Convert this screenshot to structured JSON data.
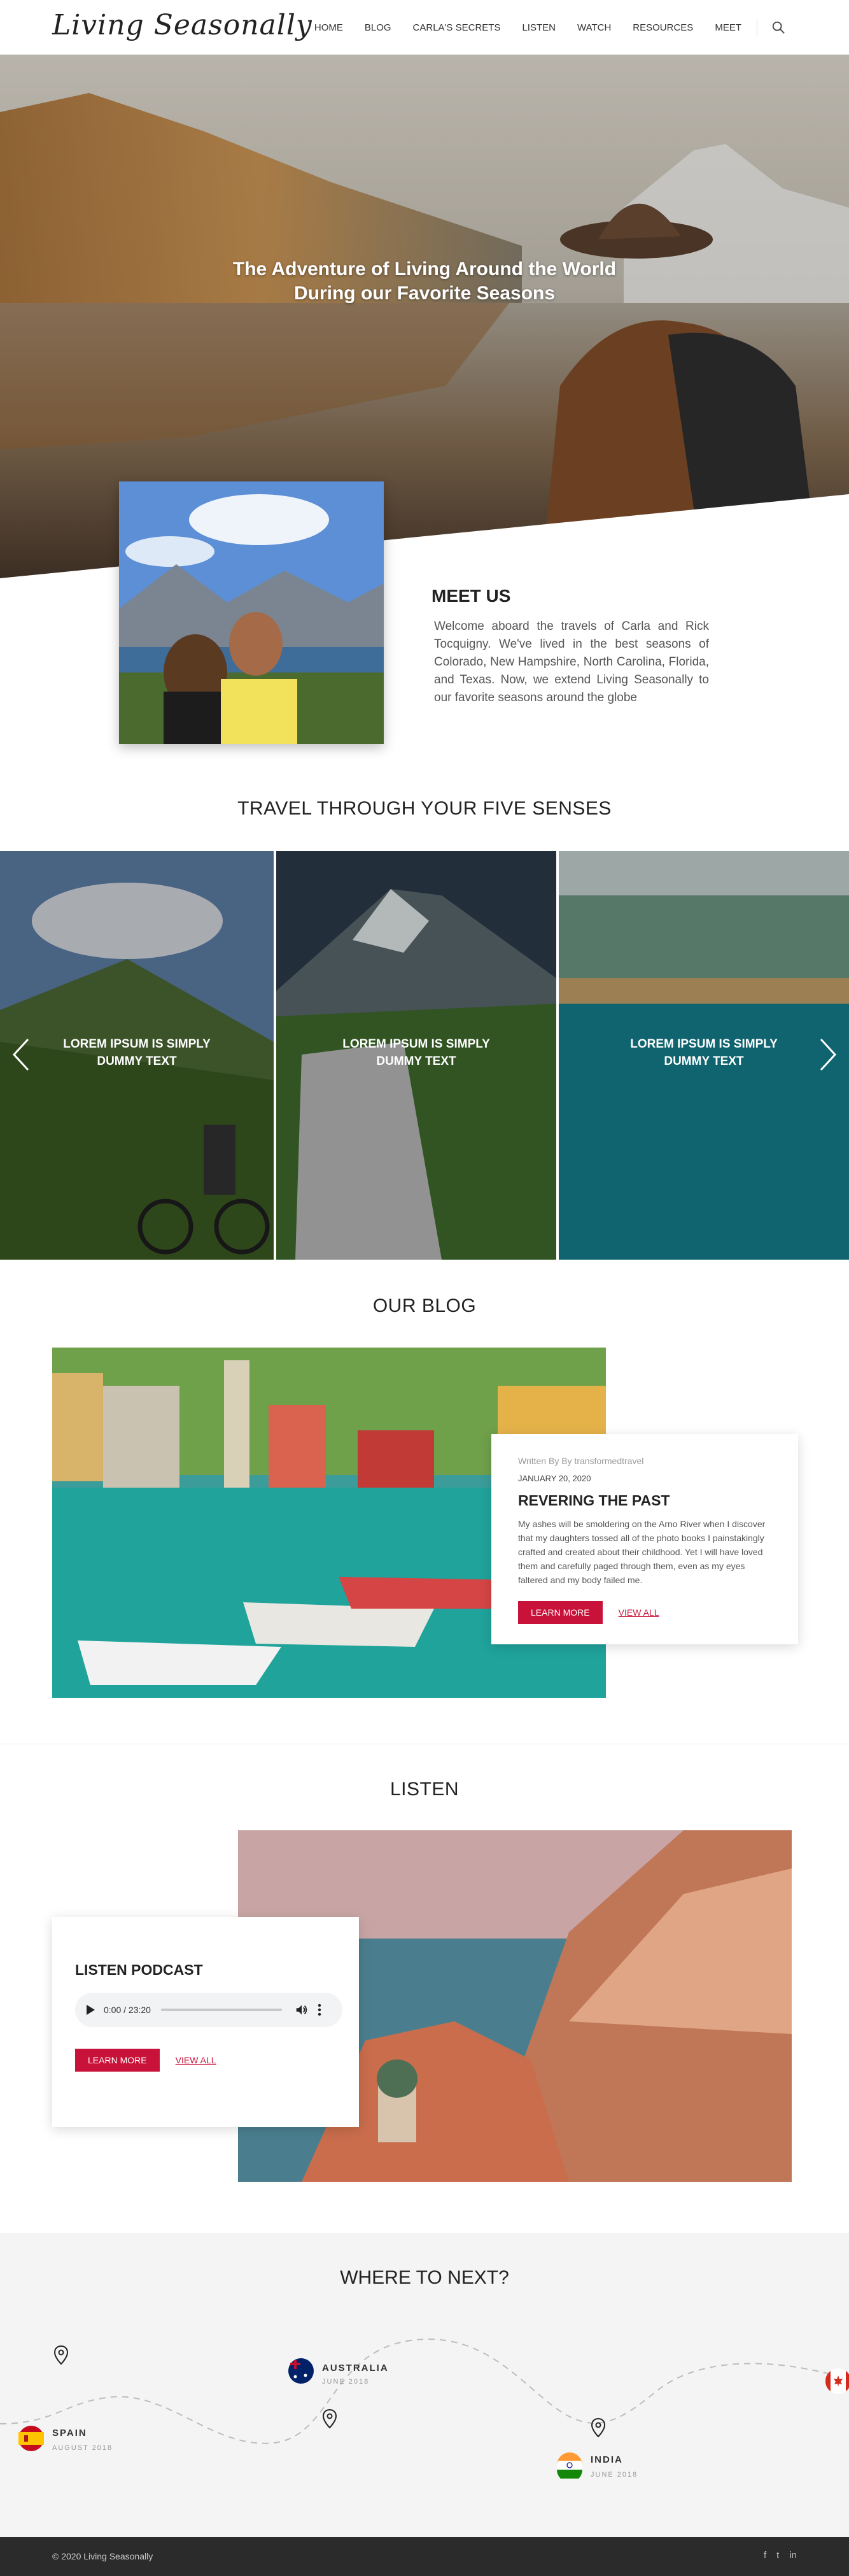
{
  "header": {
    "logo": "Living Seasonally",
    "nav": [
      "HOME",
      "BLOG",
      "CARLA'S SECRETS",
      "LISTEN",
      "WATCH",
      "RESOURCES",
      "MEET"
    ]
  },
  "hero": {
    "title_line1": "The Adventure of Living Around the World",
    "title_line2": "During our Favorite Seasons"
  },
  "meet": {
    "heading": "MEET US",
    "text": "Welcome aboard the travels of Carla and Rick Tocquigny. We've lived in the best seasons of Colorado, New Hampshire, North Carolina, Florida, and Texas. Now, we extend Living Seasonally to our favorite seasons around the globe"
  },
  "senses": {
    "title": "TRAVEL THROUGH YOUR FIVE SENSES",
    "slides": [
      {
        "caption_line1": "LOREM IPSUM IS SIMPLY",
        "caption_line2": "DUMMY TEXT"
      },
      {
        "caption_line1": "LOREM IPSUM IS SIMPLY",
        "caption_line2": "DUMMY TEXT"
      },
      {
        "caption_line1": "LOREM IPSUM IS SIMPLY",
        "caption_line2": "DUMMY TEXT"
      }
    ]
  },
  "blog": {
    "title": "OUR BLOG",
    "meta": "Written By By transformedtravel",
    "date": "JANUARY 20, 2020",
    "post_title": "REVERING THE PAST",
    "excerpt": "My ashes will be smoldering on the Arno River when I discover that my daughters tossed all of the photo books I painstakingly crafted and created about their childhood. Yet I will have loved them and carefully paged through them, even as my eyes faltered and my body failed me.",
    "learn_more": "LEARN MORE",
    "view_all": "VIEW ALL"
  },
  "listen": {
    "title": "LISTEN",
    "card_title": "LISTEN PODCAST",
    "audio_time": "0:00 / 23:20",
    "learn_more": "LEARN MORE",
    "view_all": "VIEW ALL"
  },
  "where": {
    "title": "WHERE TO NEXT?",
    "destinations": [
      {
        "name": "SPAIN",
        "date": "AUGUST 2018"
      },
      {
        "name": "AUSTRALIA",
        "date": "JUNE 2018"
      },
      {
        "name": "INDIA",
        "date": "JUNE 2018"
      }
    ]
  },
  "footer": {
    "copyright": "© 2020 Living Seasonally",
    "social": [
      "f",
      "t",
      "in"
    ]
  },
  "colors": {
    "accent": "#c8123a",
    "footer_bg": "#2b2b2b",
    "section_bg": "#f4f4f4"
  }
}
